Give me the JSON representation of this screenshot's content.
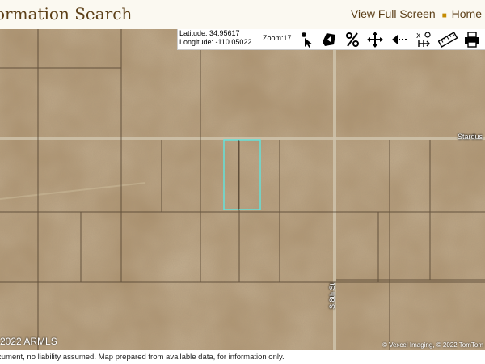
{
  "header": {
    "title": "ormation Search",
    "view_full_screen": "View Full Screen",
    "home": "Home"
  },
  "toolbar": {
    "latitude": "Latitude: 34.95617",
    "longitude": "Longitude: -110.05022",
    "zoom": "Zoom:17",
    "tools": [
      "pointer-star-icon",
      "shape-icon",
      "percent-icon",
      "pan-arrows-icon",
      "back-arrow-icon",
      "measure-xy-icon",
      "ruler-icon",
      "print-icon"
    ]
  },
  "map": {
    "road_label_horizontal": "Stardus",
    "road_label_vertical": "S 8th St",
    "attribution": "© Vexcel Imaging, © 2022 TomTom",
    "copyright": "2022 ARMLS",
    "colors": {
      "land": "#a98e6a",
      "parcel_line": "#4a3a28",
      "selected_parcel": "#5ee6e0",
      "road": "#cfc3ac"
    }
  },
  "footer": {
    "disclaimer": "cument, no liability assumed. Map prepared from available data, for information only."
  }
}
